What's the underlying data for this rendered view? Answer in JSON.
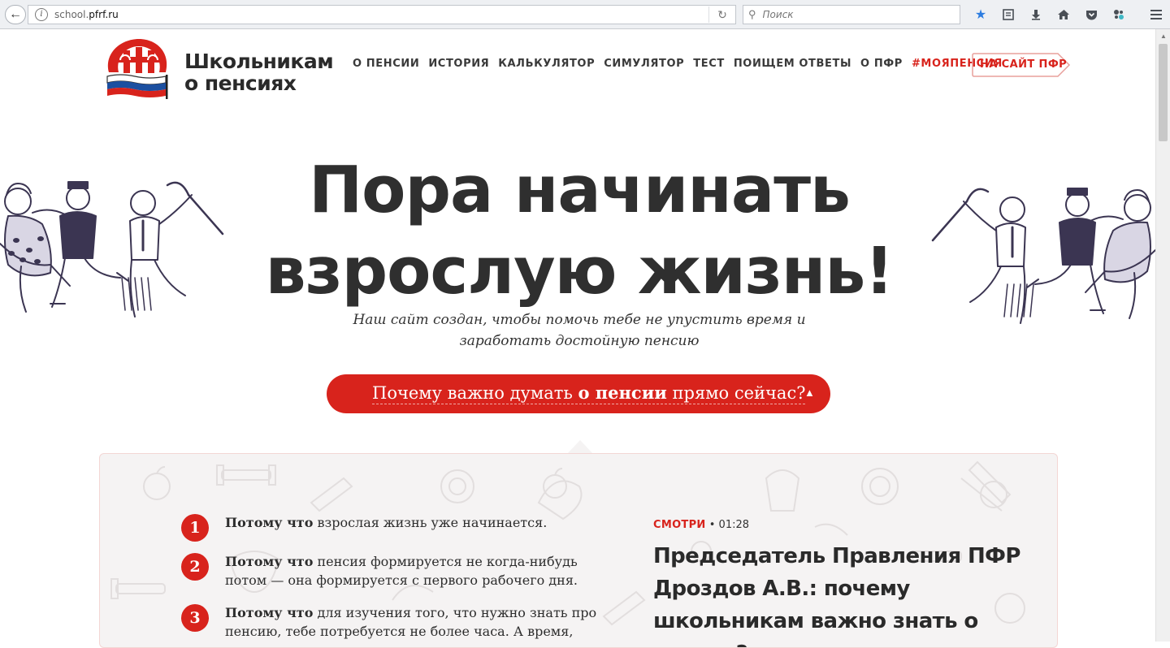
{
  "browser": {
    "url_prefix": "school.",
    "url_domain": "pfrf.ru",
    "search_placeholder": "Поиск"
  },
  "site": {
    "brand_line1": "Школьникам",
    "brand_line2": "о пенсиях",
    "nav": [
      "О ПЕНСИИ",
      "ИСТОРИЯ",
      "КАЛЬКУЛЯТОР",
      "СИМУЛЯТОР",
      "ТЕСТ",
      "ПОИЩЕМ ОТВЕТЫ",
      "О ПФР"
    ],
    "hashtag_part1": "#МОЯ",
    "hashtag_part2": "ПЕНСИЯ",
    "pfr_button": "НА САЙТ ПФР"
  },
  "hero": {
    "title_line1": "Пора начинать",
    "title_line2": "взрослую жизнь!",
    "subtitle_line1": "Наш сайт создан, чтобы помочь тебе не упустить время и",
    "subtitle_line2": "заработать достойную пенсию",
    "cta_before": "Почему важно думать ",
    "cta_bold": "о пенсии",
    "cta_after": " прямо сейчас?",
    "cta_arrow": "▲"
  },
  "reasons": [
    {
      "num": "1",
      "lead": "Потому что",
      "text": " взрослая жизнь уже начинается."
    },
    {
      "num": "2",
      "lead": "Потому что",
      "text": " пенсия формируется не когда-нибудь потом — она формируется с первого рабочего дня."
    },
    {
      "num": "3",
      "lead": "Потому что",
      "text": " для изучения того, что нужно знать про пенсию, тебе потребуется не более часа. А время, когда"
    }
  ],
  "video": {
    "label": "СМОТРИ",
    "separator": " • ",
    "duration": "01:28",
    "title": "Председатель Правления ПФР Дроздов А.В.: почему школьникам важно знать о пенсии?"
  },
  "colors": {
    "accent": "#d8231c",
    "text": "#2f2f2f",
    "panel_bg": "#f5f3f3",
    "flag_blue": "#1b4fa0"
  }
}
